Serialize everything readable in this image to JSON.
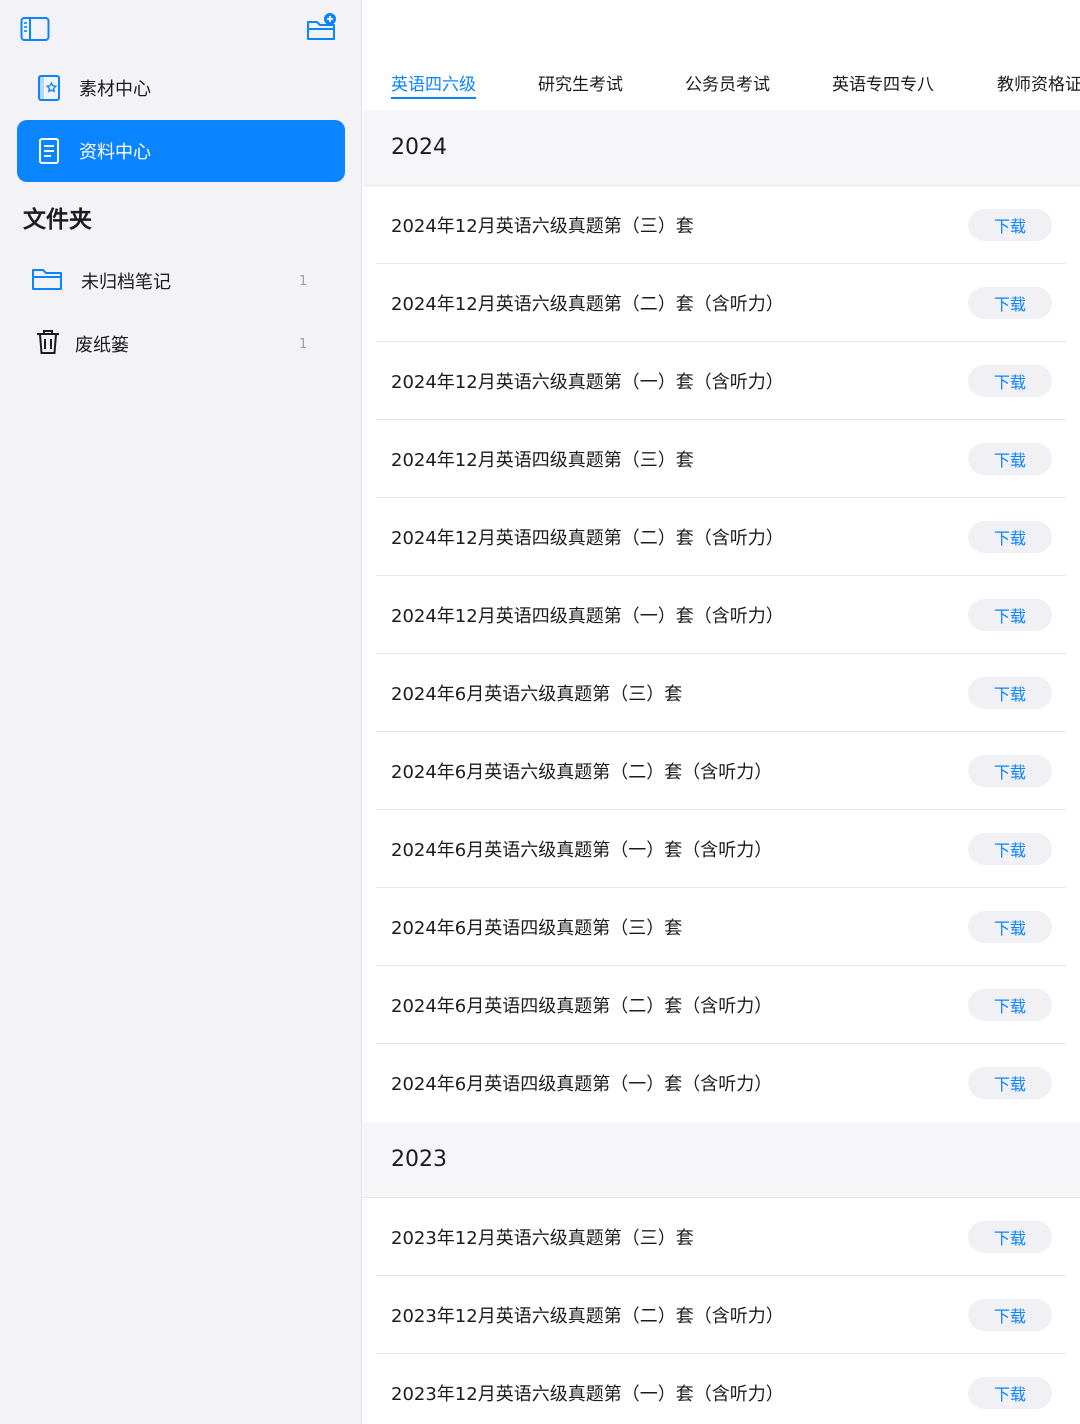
{
  "sidebar": {
    "nav": [
      {
        "label": "素材中心",
        "icon": "star-document-icon",
        "active": false
      },
      {
        "label": "资料中心",
        "icon": "document-icon",
        "active": true
      }
    ],
    "section_title": "文件夹",
    "folders": [
      {
        "label": "未归档笔记",
        "count": "1",
        "icon": "folder-icon"
      },
      {
        "label": "废纸篓",
        "count": "1",
        "icon": "trash-icon"
      }
    ]
  },
  "tabs": [
    "英语四六级",
    "研究生考试",
    "公务员考试",
    "英语专四专八",
    "教师资格证"
  ],
  "active_tab": 0,
  "download_label": "下载",
  "accent_color": "#0a84ff",
  "groups": [
    {
      "year": "2024",
      "items": [
        "2024年12月英语六级真题第（三）套",
        "2024年12月英语六级真题第（二）套（含听力）",
        "2024年12月英语六级真题第（一）套（含听力）",
        "2024年12月英语四级真题第（三）套",
        "2024年12月英语四级真题第（二）套（含听力）",
        "2024年12月英语四级真题第（一）套（含听力）",
        "2024年6月英语六级真题第（三）套",
        "2024年6月英语六级真题第（二）套（含听力）",
        "2024年6月英语六级真题第（一）套（含听力）",
        "2024年6月英语四级真题第（三）套",
        "2024年6月英语四级真题第（二）套（含听力）",
        "2024年6月英语四级真题第（一）套（含听力）"
      ]
    },
    {
      "year": "2023",
      "items": [
        "2023年12月英语六级真题第（三）套",
        "2023年12月英语六级真题第（二）套（含听力）",
        "2023年12月英语六级真题第（一）套（含听力）"
      ]
    }
  ]
}
